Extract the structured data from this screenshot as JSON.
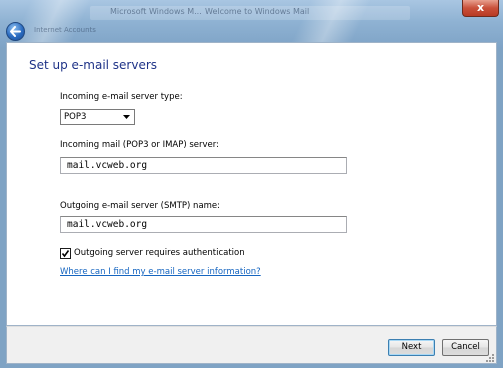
{
  "window": {
    "title_left": "Microsoft Windows M...",
    "title_right": "Welcome to Windows Mail",
    "subtitle": "Internet Accounts",
    "close_glyph": "x"
  },
  "page": {
    "heading": "Set up e-mail servers"
  },
  "form": {
    "server_type_label": "Incoming e-mail server type:",
    "server_type_value": "POP3",
    "incoming_label": "Incoming mail (POP3 or IMAP) server:",
    "incoming_value": "mail.vcweb.org",
    "outgoing_label": "Outgoing e-mail server (SMTP) name:",
    "outgoing_value": "mail.vcweb.org",
    "auth_label": "Outgoing server requires authentication",
    "auth_checked": true,
    "help_link": "Where can I find my e-mail server information?"
  },
  "footer": {
    "next_label": "Next",
    "cancel_label": "Cancel"
  },
  "icons": {
    "back": "back-arrow-icon",
    "dropdown": "chevron-down-icon",
    "check": "checkmark-icon"
  },
  "colors": {
    "heading": "#1e3287",
    "link": "#1565c0",
    "glass": "#8fb2d3"
  }
}
